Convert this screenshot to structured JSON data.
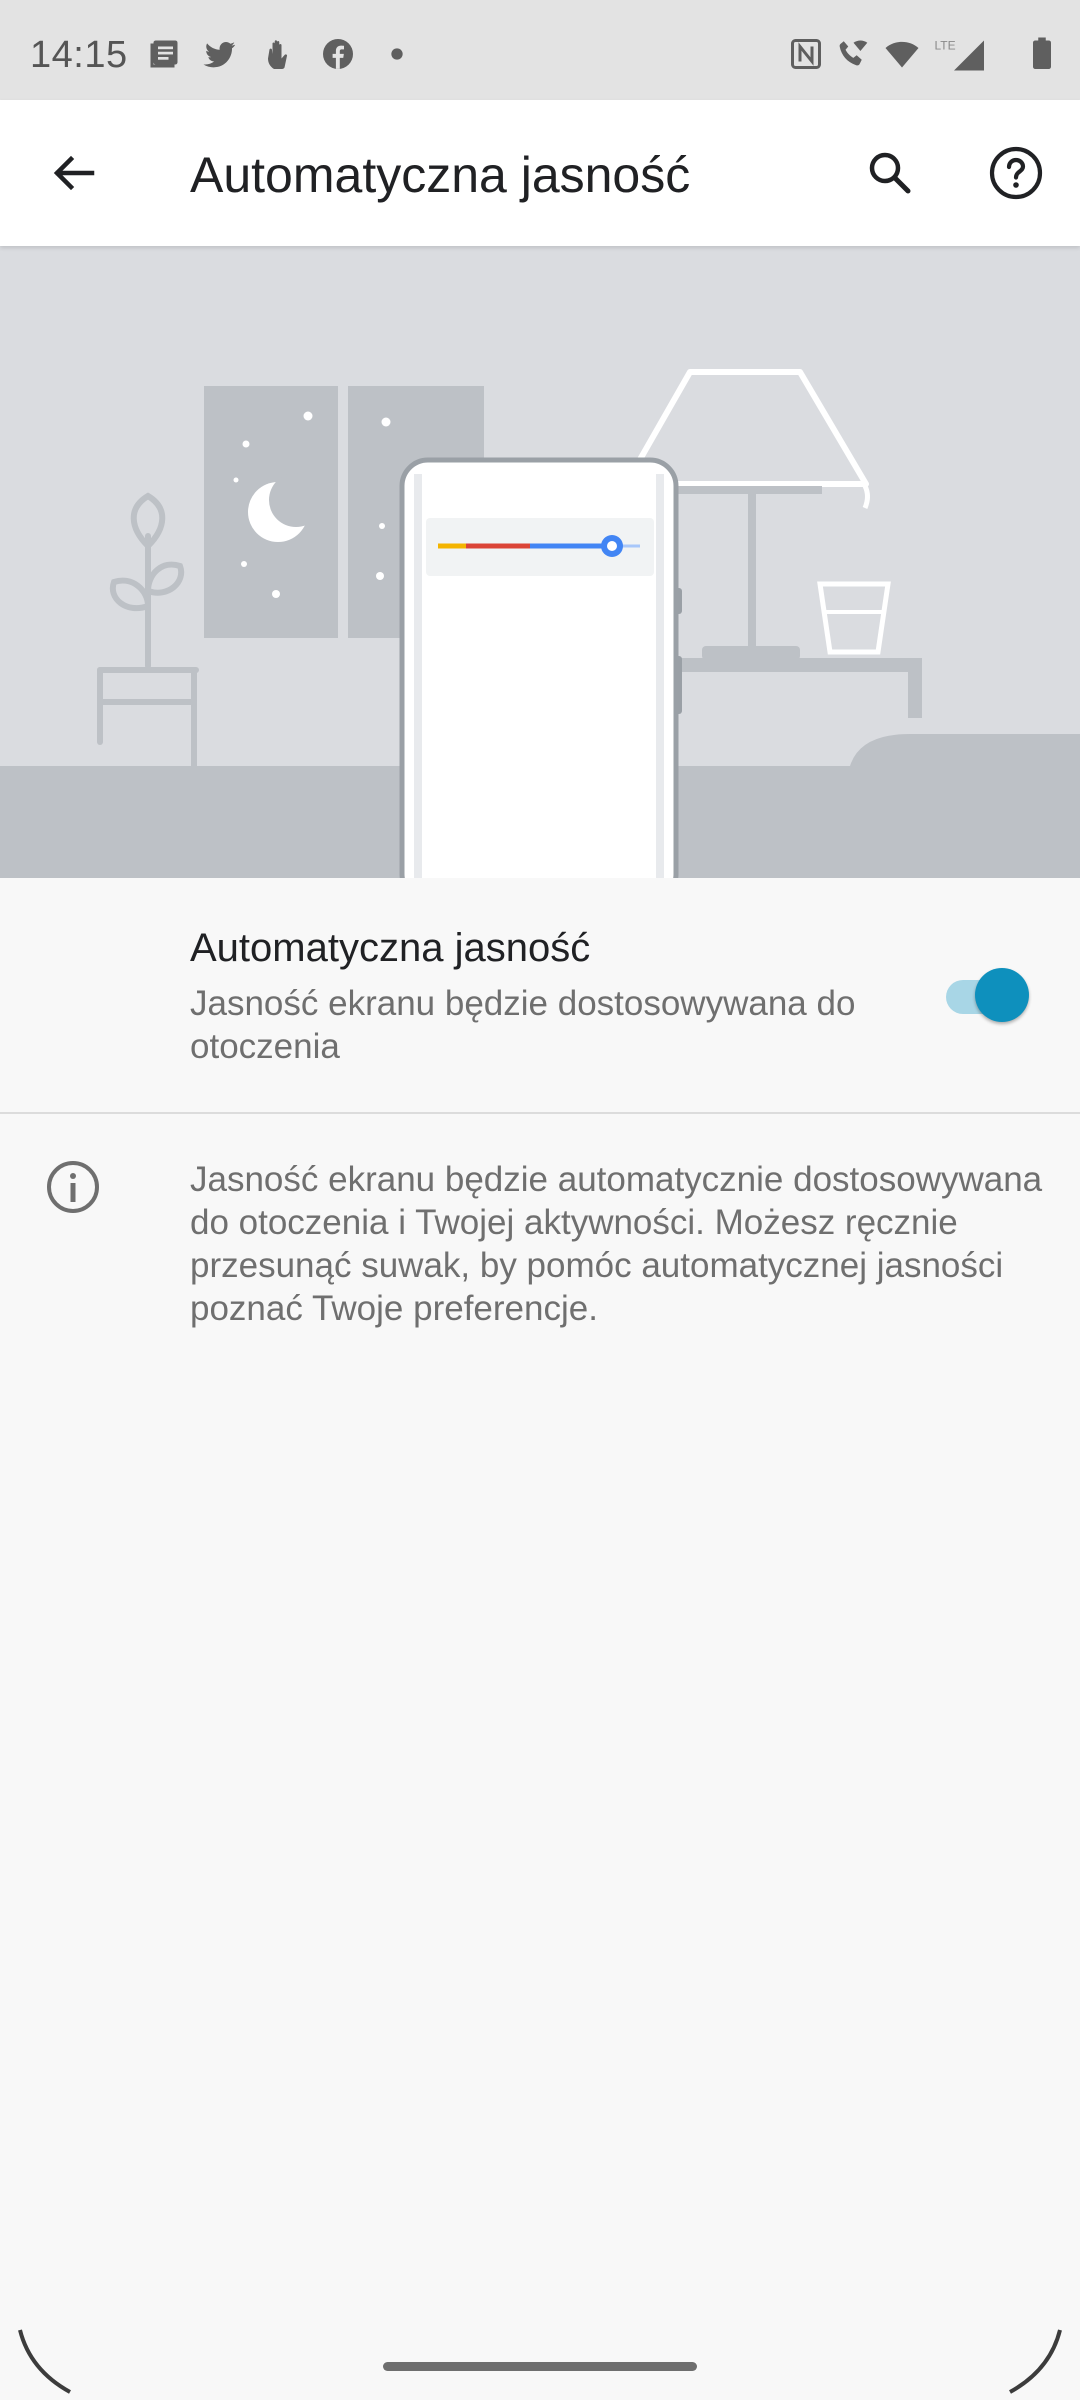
{
  "status_bar": {
    "time": "14:15",
    "left_icons": [
      "notes-icon",
      "twitter-icon",
      "hand-icon",
      "facebook-icon",
      "dot-icon"
    ],
    "right_icons": [
      "nfc-icon",
      "wifi-calling-icon",
      "wifi-icon",
      "lte-signal-icon",
      "battery-icon"
    ],
    "network_label": "LTE"
  },
  "app_bar": {
    "title": "Automatyczna jasność",
    "back_icon": "arrow-back-icon",
    "search_icon": "search-icon",
    "help_icon": "help-icon"
  },
  "illustration": {
    "slider_colors": [
      "#f4b400",
      "#db4437",
      "#4285f4"
    ],
    "background_color": "#dadce0"
  },
  "setting": {
    "title": "Automatyczna jasność",
    "summary": "Jasność ekranu będzie dostosowywana do otoczenia",
    "toggle_on": true,
    "accent_color": "#0e90bd"
  },
  "info": {
    "icon": "info-icon",
    "text": "Jasność ekranu będzie automatycznie dostosowywana do otoczenia i Twojej aktywności. Możesz ręcznie przesunąć suwak, by pomóc automatycznej jasności poznać Twoje preferencje."
  }
}
